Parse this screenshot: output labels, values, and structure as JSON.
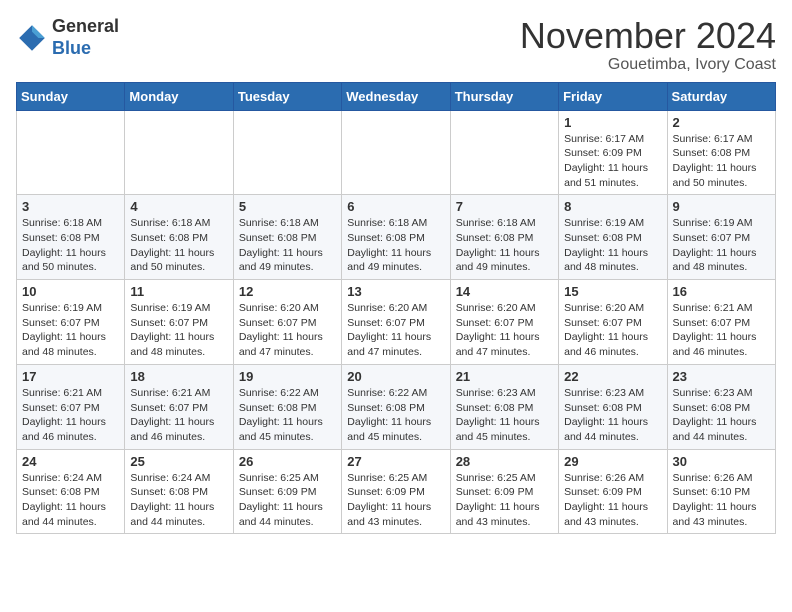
{
  "logo": {
    "general": "General",
    "blue": "Blue"
  },
  "header": {
    "month": "November 2024",
    "location": "Gouetimba, Ivory Coast"
  },
  "weekdays": [
    "Sunday",
    "Monday",
    "Tuesday",
    "Wednesday",
    "Thursday",
    "Friday",
    "Saturday"
  ],
  "weeks": [
    [
      {
        "day": "",
        "info": ""
      },
      {
        "day": "",
        "info": ""
      },
      {
        "day": "",
        "info": ""
      },
      {
        "day": "",
        "info": ""
      },
      {
        "day": "",
        "info": ""
      },
      {
        "day": "1",
        "info": "Sunrise: 6:17 AM\nSunset: 6:09 PM\nDaylight: 11 hours and 51 minutes."
      },
      {
        "day": "2",
        "info": "Sunrise: 6:17 AM\nSunset: 6:08 PM\nDaylight: 11 hours and 50 minutes."
      }
    ],
    [
      {
        "day": "3",
        "info": "Sunrise: 6:18 AM\nSunset: 6:08 PM\nDaylight: 11 hours and 50 minutes."
      },
      {
        "day": "4",
        "info": "Sunrise: 6:18 AM\nSunset: 6:08 PM\nDaylight: 11 hours and 50 minutes."
      },
      {
        "day": "5",
        "info": "Sunrise: 6:18 AM\nSunset: 6:08 PM\nDaylight: 11 hours and 49 minutes."
      },
      {
        "day": "6",
        "info": "Sunrise: 6:18 AM\nSunset: 6:08 PM\nDaylight: 11 hours and 49 minutes."
      },
      {
        "day": "7",
        "info": "Sunrise: 6:18 AM\nSunset: 6:08 PM\nDaylight: 11 hours and 49 minutes."
      },
      {
        "day": "8",
        "info": "Sunrise: 6:19 AM\nSunset: 6:08 PM\nDaylight: 11 hours and 48 minutes."
      },
      {
        "day": "9",
        "info": "Sunrise: 6:19 AM\nSunset: 6:07 PM\nDaylight: 11 hours and 48 minutes."
      }
    ],
    [
      {
        "day": "10",
        "info": "Sunrise: 6:19 AM\nSunset: 6:07 PM\nDaylight: 11 hours and 48 minutes."
      },
      {
        "day": "11",
        "info": "Sunrise: 6:19 AM\nSunset: 6:07 PM\nDaylight: 11 hours and 48 minutes."
      },
      {
        "day": "12",
        "info": "Sunrise: 6:20 AM\nSunset: 6:07 PM\nDaylight: 11 hours and 47 minutes."
      },
      {
        "day": "13",
        "info": "Sunrise: 6:20 AM\nSunset: 6:07 PM\nDaylight: 11 hours and 47 minutes."
      },
      {
        "day": "14",
        "info": "Sunrise: 6:20 AM\nSunset: 6:07 PM\nDaylight: 11 hours and 47 minutes."
      },
      {
        "day": "15",
        "info": "Sunrise: 6:20 AM\nSunset: 6:07 PM\nDaylight: 11 hours and 46 minutes."
      },
      {
        "day": "16",
        "info": "Sunrise: 6:21 AM\nSunset: 6:07 PM\nDaylight: 11 hours and 46 minutes."
      }
    ],
    [
      {
        "day": "17",
        "info": "Sunrise: 6:21 AM\nSunset: 6:07 PM\nDaylight: 11 hours and 46 minutes."
      },
      {
        "day": "18",
        "info": "Sunrise: 6:21 AM\nSunset: 6:07 PM\nDaylight: 11 hours and 46 minutes."
      },
      {
        "day": "19",
        "info": "Sunrise: 6:22 AM\nSunset: 6:08 PM\nDaylight: 11 hours and 45 minutes."
      },
      {
        "day": "20",
        "info": "Sunrise: 6:22 AM\nSunset: 6:08 PM\nDaylight: 11 hours and 45 minutes."
      },
      {
        "day": "21",
        "info": "Sunrise: 6:23 AM\nSunset: 6:08 PM\nDaylight: 11 hours and 45 minutes."
      },
      {
        "day": "22",
        "info": "Sunrise: 6:23 AM\nSunset: 6:08 PM\nDaylight: 11 hours and 44 minutes."
      },
      {
        "day": "23",
        "info": "Sunrise: 6:23 AM\nSunset: 6:08 PM\nDaylight: 11 hours and 44 minutes."
      }
    ],
    [
      {
        "day": "24",
        "info": "Sunrise: 6:24 AM\nSunset: 6:08 PM\nDaylight: 11 hours and 44 minutes."
      },
      {
        "day": "25",
        "info": "Sunrise: 6:24 AM\nSunset: 6:08 PM\nDaylight: 11 hours and 44 minutes."
      },
      {
        "day": "26",
        "info": "Sunrise: 6:25 AM\nSunset: 6:09 PM\nDaylight: 11 hours and 44 minutes."
      },
      {
        "day": "27",
        "info": "Sunrise: 6:25 AM\nSunset: 6:09 PM\nDaylight: 11 hours and 43 minutes."
      },
      {
        "day": "28",
        "info": "Sunrise: 6:25 AM\nSunset: 6:09 PM\nDaylight: 11 hours and 43 minutes."
      },
      {
        "day": "29",
        "info": "Sunrise: 6:26 AM\nSunset: 6:09 PM\nDaylight: 11 hours and 43 minutes."
      },
      {
        "day": "30",
        "info": "Sunrise: 6:26 AM\nSunset: 6:10 PM\nDaylight: 11 hours and 43 minutes."
      }
    ]
  ]
}
